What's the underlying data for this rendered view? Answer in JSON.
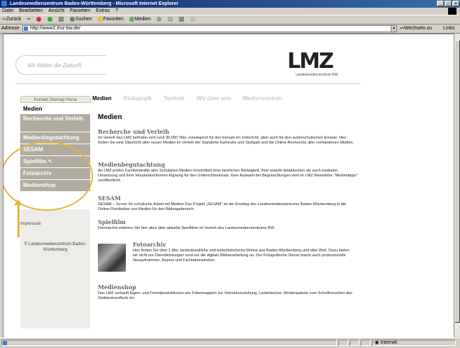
{
  "window": {
    "title": "Landesmedienzentrum Baden-Württemberg - Microsoft Internet Explorer"
  },
  "menu": [
    "Datei",
    "Bearbeiten",
    "Ansicht",
    "Favoriten",
    "Extras",
    "?"
  ],
  "toolbar": {
    "back": "Zurück",
    "search": "Suchen",
    "favorites": "Favoriten",
    "media": "Medien"
  },
  "address": {
    "label": "Adresse",
    "url": "http://www2.lmz-bw.de/",
    "go": "Wechseln zu",
    "links": "Links"
  },
  "site": {
    "slogan": "Wir bilden die Zukunft.",
    "logo": "LMZ",
    "logo_tag": "Landesmedienzentrum BW",
    "utility_nav": "Kontakt  Sitemap  Home",
    "topnav": [
      "Medien",
      "Pädagogik",
      "Technik",
      "Wir über uns",
      "Medienzentren"
    ],
    "sidebar": [
      "Medien",
      "Recherche und Verleih",
      "Medienbegutachtung",
      "SESAM",
      "Spielfilm",
      "Fotoarchiv",
      "Medienshop"
    ],
    "impressum": "Impressum",
    "copyright": "© Landesmedienzentrum Baden-Württemberg"
  },
  "content": {
    "title": "Medien",
    "sections": [
      {
        "heading": "Recherche und Verleih",
        "text": "Im Verleih des LMZ befinden sich rund 30.000 Titel, vorwiegend für den Einsatz im Unterricht, aber auch für den außerschulischen Einsatz. Hier finden Sie eine Übersicht aller neuen Medien im Verleih der Standorte Karlsruhe und Stuttgart und die Online-Recherche aller vorhandenen Medien."
      },
      {
        "heading": "Medienbegutachtung",
        "text": "An LMZ prüfen Fachlehrkräfte aller Schularten Medien hinsichtlich ihrer fachlichen Richtigkeit, ihrer sowohl didaktischen als auch medialen Umsetzung und ihrer lehrplankonformen Eignung für den Unterrichtseinsatz. Eine Auswahl der Begutachtungen wird im LMZ-Newsletter \"Medientipps\" veröffentlicht."
      },
      {
        "heading": "SESAM",
        "text": "SESAM – Server für schulische Arbeit mit Medien Das Projekt „SESAM“ ist der Einstieg des Landesmedienzentrums Baden-Württemberg in die Online-Distribution von Medien für den Bildungsbereich."
      },
      {
        "heading": "Spielfilm",
        "text": "Demnächst erfahren Sie hier alles über aktuelle Spielfilme im Verleih des Landesmedienzentrums BW."
      },
      {
        "heading": "Fotoarchiv",
        "text": "Hier finden Sie über 1 Mio. landeskundliche und kulturhistorische Motive aus Baden-Württemberg und aller Welt. Dazu bieten wir nicht nur Dienstleistungen rund um die digitale Bildverarbeitung an. Der Fotografische Dienst macht auch professionelle Neuaufnahmen, Repros und Fachlaborarbeiten."
      },
      {
        "heading": "Medienshop",
        "text": "Das LMZ verkauft Eigen- und Fremdproduktionen wie Folienmappen zur Verkehrserziehung, Liederbücher, Medienpakete zum Schulfernsehen des Südwestrundfunk etc."
      }
    ]
  },
  "status": {
    "zone": "Internet"
  }
}
